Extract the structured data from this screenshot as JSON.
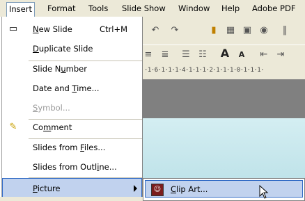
{
  "menubar": {
    "items": [
      {
        "label": "Insert",
        "active": true
      },
      {
        "label": "Format"
      },
      {
        "label": "Tools"
      },
      {
        "label": "Slide Show"
      },
      {
        "label": "Window"
      },
      {
        "label": "Help"
      },
      {
        "label": "Adobe PDF"
      }
    ]
  },
  "menu": {
    "items": [
      {
        "label": "New Slide",
        "shortcut": "Ctrl+M",
        "icon": "new-slide-icon"
      },
      {
        "label": "Duplicate Slide"
      },
      {
        "label": "Slide Number"
      },
      {
        "label": "Date and Time..."
      },
      {
        "label": "Symbol...",
        "disabled": true
      },
      {
        "label": "Comment",
        "icon": "comment-icon"
      },
      {
        "label": "Slides from Files..."
      },
      {
        "label": "Slides from Outline..."
      },
      {
        "label": "Picture",
        "highlighted": true,
        "submenu": true
      }
    ]
  },
  "submenu": {
    "items": [
      {
        "label": "Clip Art...",
        "icon": "clip-art-icon"
      }
    ]
  },
  "ruler": {
    "text": "·1·6·1·1·1·4·1·1·1·2·1·1·1·0·1·1·1·"
  },
  "colors": {
    "menubar_bg": "#ece9d8",
    "highlight_bg": "#c1d2ee",
    "highlight_border": "#316ac5",
    "slide_bg": "#c6e7ec",
    "workspace_gray": "#808080"
  }
}
